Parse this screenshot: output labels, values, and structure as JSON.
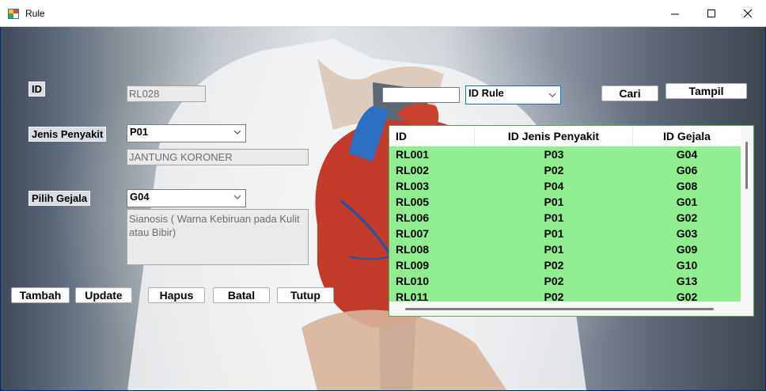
{
  "window": {
    "title": "Rule"
  },
  "form": {
    "id_label": "ID",
    "id_value": "RL028",
    "jenis_label": "Jenis Penyakit",
    "jenis_selected": "P01",
    "jenis_name": "JANTUNG KORONER",
    "gejala_label": "Pilih Gejala",
    "gejala_selected": "G04",
    "gejala_desc": "Sianosis ( Warna Kebiruan pada Kulit atau Bibir)"
  },
  "actions": {
    "tambah": "Tambah",
    "update": "Update",
    "hapus": "Hapus",
    "batal": "Batal",
    "tutup": "Tutup"
  },
  "search": {
    "value": "",
    "filter_selected": "ID Rule",
    "cari": "Cari",
    "tampil": "Tampil"
  },
  "grid": {
    "columns": [
      "ID",
      "ID Jenis Penyakit",
      "ID Gejala"
    ],
    "rows": [
      [
        "RL001",
        "P03",
        "G04"
      ],
      [
        "RL002",
        "P02",
        "G06"
      ],
      [
        "RL003",
        "P04",
        "G08"
      ],
      [
        "RL005",
        "P01",
        "G01"
      ],
      [
        "RL006",
        "P01",
        "G02"
      ],
      [
        "RL007",
        "P01",
        "G03"
      ],
      [
        "RL008",
        "P01",
        "G09"
      ],
      [
        "RL009",
        "P02",
        "G10"
      ],
      [
        "RL010",
        "P02",
        "G13"
      ],
      [
        "RL011",
        "P02",
        "G02"
      ]
    ],
    "row_color": "#90ee90",
    "border_color": "#57a657"
  },
  "icons": {
    "app": "app-icon",
    "minimize": "minimize-icon",
    "maximize": "maximize-icon",
    "close": "close-icon",
    "dropdown": "chevron-down-icon"
  },
  "colors": {
    "window_frame": "#002a6e",
    "titlebar": "#ffffff",
    "selection_border": "#0078d7"
  }
}
